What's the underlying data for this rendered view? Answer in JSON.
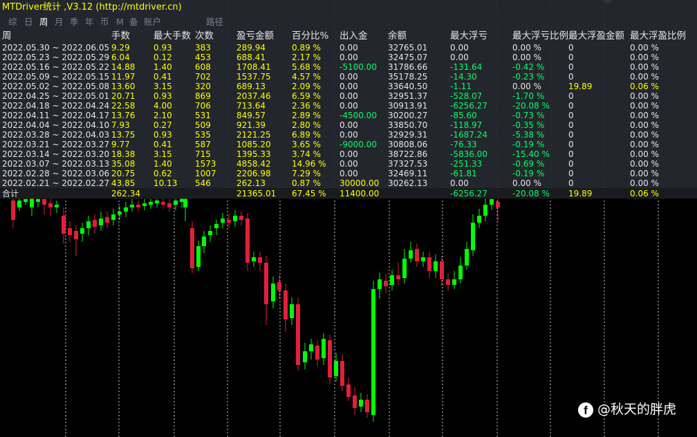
{
  "title": "MTDriver统计 ,V3.12 (http://mtdriver.cn)",
  "colors": {
    "panel_bg": "#262a30",
    "yellow": "#ffff00",
    "green": "#00ff66",
    "white": "#e6e6e6",
    "candle_up": "#00ff00",
    "candle_down": "#e0203a",
    "tab_inactive": "#77808a"
  },
  "tabs": [
    {
      "label": "综"
    },
    {
      "label": "日"
    },
    {
      "label": "周",
      "active": true
    },
    {
      "label": "月"
    },
    {
      "label": "季"
    },
    {
      "label": "年"
    },
    {
      "label": "币"
    },
    {
      "label": "M"
    },
    {
      "label": "备"
    },
    {
      "label": "账户"
    },
    {
      "label": "路径"
    }
  ],
  "table": {
    "headers": [
      "周",
      "手数",
      "最大手数",
      "次数",
      "盈亏金额",
      "百分比%",
      "出入金",
      "余额",
      "最大浮亏",
      "最大浮亏比例",
      "最大浮盈金额",
      "最大浮盈比例"
    ],
    "rows": [
      [
        "2022.05.30 ~ 2022.06.05",
        "9.29",
        "0.93",
        "383",
        "289.94",
        "0.89 %",
        "0.00",
        "32765.01",
        "0.00",
        "0.00 %",
        "0",
        "0.00 %"
      ],
      [
        "2022.05.23 ~ 2022.05.29",
        "6.04",
        "0.12",
        "453",
        "688.41",
        "2.17 %",
        "0.00",
        "32475.07",
        "0.00",
        "0.00 %",
        "0",
        "0.00 %"
      ],
      [
        "2022.05.16 ~ 2022.05.22",
        "14.88",
        "1.40",
        "608",
        "1708.41",
        "5.68 %",
        "-5100.00",
        "31786.66",
        "-131.64",
        "-0.42 %",
        "0",
        "0.00 %"
      ],
      [
        "2022.05.09 ~ 2022.05.15",
        "11.97",
        "0.41",
        "702",
        "1537.75",
        "4.57 %",
        "0.00",
        "35178.25",
        "-14.30",
        "-0.23 %",
        "0",
        "0.00 %"
      ],
      [
        "2022.05.02 ~ 2022.05.08",
        "13.60",
        "3.15",
        "320",
        "689.13",
        "2.09 %",
        "0.00",
        "33640.50",
        "-1.11",
        "0.00 %",
        "19.89",
        "0.06 %"
      ],
      [
        "2022.04.25 ~ 2022.05.01",
        "20.71",
        "0.93",
        "869",
        "2037.46",
        "6.59 %",
        "0.00",
        "32951.37",
        "-528.07",
        "-1.70 %",
        "0",
        "0.00 %"
      ],
      [
        "2022.04.18 ~ 2022.04.24",
        "22.58",
        "4.00",
        "706",
        "713.64",
        "2.36 %",
        "0.00",
        "30913.91",
        "-6256.27",
        "-20.08 %",
        "0",
        "0.00 %"
      ],
      [
        "2022.04.11 ~ 2022.04.17",
        "13.76",
        "2.10",
        "531",
        "849.57",
        "2.89 %",
        "-4500.00",
        "30200.27",
        "-85.60",
        "-0.73 %",
        "0",
        "0.00 %"
      ],
      [
        "2022.04.04 ~ 2022.04.10",
        "7.93",
        "0.27",
        "509",
        "921.39",
        "2.80 %",
        "0.00",
        "33850.70",
        "-118.97",
        "-0.35 %",
        "0",
        "0.00 %"
      ],
      [
        "2022.03.28 ~ 2022.04.03",
        "13.75",
        "0.93",
        "535",
        "2121.25",
        "6.89 %",
        "0.00",
        "32929.31",
        "-1687.24",
        "-5.38 %",
        "0",
        "0.00 %"
      ],
      [
        "2022.03.21 ~ 2022.03.27",
        "9.77",
        "0.41",
        "587",
        "1085.20",
        "3.65 %",
        "-9000.00",
        "30808.06",
        "-76.33",
        "-0.19 %",
        "0",
        "0.00 %"
      ],
      [
        "2022.03.14 ~ 2022.03.20",
        "18.38",
        "3.15",
        "715",
        "1395.33",
        "3.74 %",
        "0.00",
        "38722.86",
        "-5836.00",
        "-15.40 %",
        "0",
        "0.00 %"
      ],
      [
        "2022.03.07 ~ 2022.03.13",
        "35.08",
        "1.40",
        "1573",
        "4858.42",
        "14.96 %",
        "0.00",
        "37327.53",
        "-251.33",
        "-0.69 %",
        "0",
        "0.00 %"
      ],
      [
        "2022.02.28 ~ 2022.03.06",
        "20.75",
        "0.62",
        "1007",
        "2206.98",
        "7.29 %",
        "0.00",
        "32469.11",
        "-61.81",
        "-0.19 %",
        "0",
        "0.00 %"
      ],
      [
        "2022.02.21 ~ 2022.02.27",
        "43.85",
        "10.13",
        "546",
        "262.13",
        "0.87 %",
        "30000.00",
        "30262.13",
        "0.00",
        "0.00 %",
        "0",
        "0.00 %"
      ]
    ],
    "summary": [
      "合计",
      "262.34",
      "",
      "",
      "21365.01",
      "67.45 %",
      "11400.00",
      "",
      "-6256.27",
      "-20.08 %",
      "19.89",
      "0.06 %"
    ]
  },
  "watermark": {
    "icon": "facebook-icon",
    "icon_glyph": "f",
    "text": "@秋天的胖虎"
  }
}
